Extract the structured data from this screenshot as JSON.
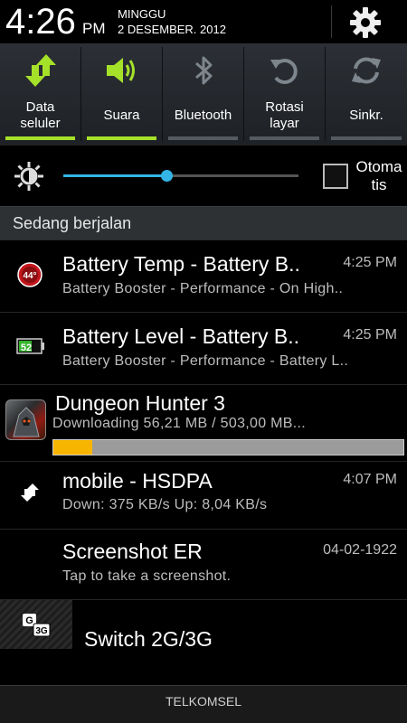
{
  "status": {
    "time": "4:26",
    "ampm": "PM",
    "day": "MINGGU",
    "date": "2 DESEMBER. 2012"
  },
  "quick_toggles": [
    {
      "label_line1": "Data",
      "label_line2": "seluler",
      "icon": "data-arrows-icon",
      "active": true
    },
    {
      "label_line1": "Suara",
      "label_line2": "",
      "icon": "speaker-icon",
      "active": true
    },
    {
      "label_line1": "Bluetooth",
      "label_line2": "",
      "icon": "bluetooth-icon",
      "active": false
    },
    {
      "label_line1": "Rotasi",
      "label_line2": "layar",
      "icon": "rotate-icon",
      "active": false
    },
    {
      "label_line1": "Sinkr.",
      "label_line2": "",
      "icon": "sync-icon",
      "active": false
    }
  ],
  "brightness": {
    "level": 0.44,
    "auto_label_line1": "Otoma",
    "auto_label_line2": "tis",
    "auto_checked": false
  },
  "section_header": "Sedang berjalan",
  "notifications": [
    {
      "title": "Battery Temp - Battery B..",
      "time": "4:25 PM",
      "sub": "Battery Booster - Performance - On High..",
      "icon": "battery-temp-icon",
      "badge": "44°"
    },
    {
      "title": "Battery Level - Battery B..",
      "time": "4:25 PM",
      "sub": "Battery Booster - Performance - Battery L..",
      "icon": "battery-level-icon",
      "badge": "52"
    },
    {
      "title": "Dungeon Hunter 3",
      "sub": "Downloading 56,21 MB / 503,00 MB...",
      "icon": "dungeon-hunter-app-icon",
      "progress": 0.1118
    },
    {
      "title": "mobile - HSDPA",
      "time": "4:07 PM",
      "sub": "Down: 375 KB/s   Up: 8,04 KB/s",
      "icon": "data-transfer-icon"
    },
    {
      "title": "Screenshot ER",
      "time": "04-02-1922",
      "sub": "Tap to take a screenshot.",
      "icon": ""
    },
    {
      "title": "Switch 2G/3G",
      "icon": "switch-2g-3g-icon",
      "badge_a": "G",
      "badge_b": "3G"
    }
  ],
  "carrier": "TELKOMSEL",
  "colors": {
    "accent": "#33b5e5",
    "active_toggle": "#a6e12a",
    "progress": "#f7b500"
  }
}
